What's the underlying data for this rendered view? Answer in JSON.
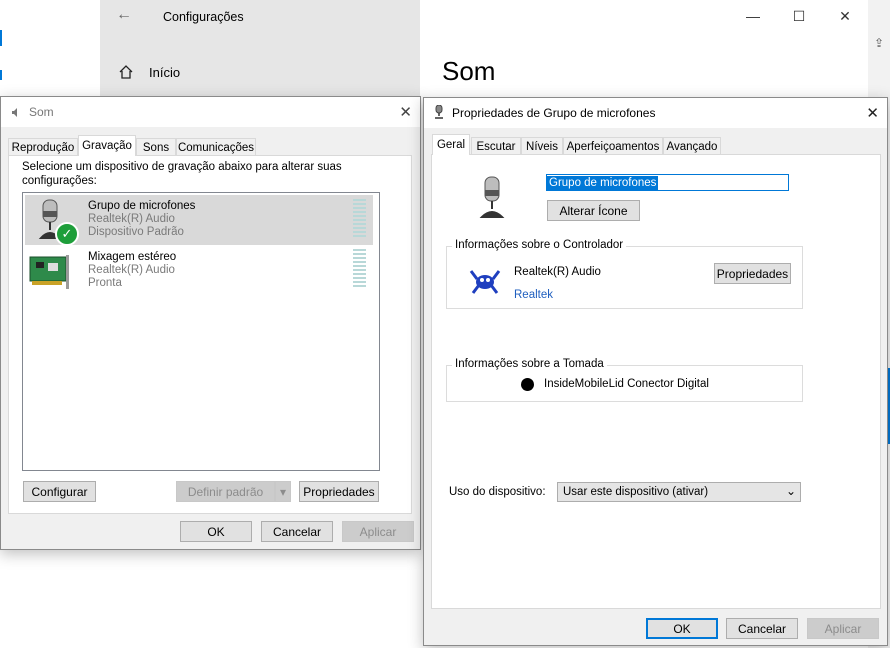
{
  "settings": {
    "title": "Configurações",
    "home": "Início",
    "page_title": "Som"
  },
  "sound_dialog": {
    "title": "Som",
    "tabs": [
      "Reprodução",
      "Gravação",
      "Sons",
      "Comunicações"
    ],
    "instruction": "Selecione um dispositivo de gravação abaixo para alterar suas configurações:",
    "devices": [
      {
        "name": "Grupo de microfones",
        "driver": "Realtek(R) Audio",
        "status": "Dispositivo Padrão"
      },
      {
        "name": "Mixagem estéreo",
        "driver": "Realtek(R) Audio",
        "status": "Pronta"
      }
    ],
    "configure": "Configurar",
    "set_default": "Definir padrão",
    "properties": "Propriedades",
    "ok": "OK",
    "cancel": "Cancelar",
    "apply": "Aplicar"
  },
  "props_dialog": {
    "title": "Propriedades de Grupo de microfones",
    "tabs": [
      "Geral",
      "Escutar",
      "Níveis",
      "Aperfeiçoamentos",
      "Avançado"
    ],
    "device_name": "Grupo de microfones",
    "change_icon": "Alterar Ícone",
    "controller_group": "Informações sobre o Controlador",
    "controller_name": "Realtek(R) Audio",
    "controller_vendor": "Realtek",
    "controller_props": "Propriedades",
    "jack_group": "Informações sobre a Tomada",
    "jack_name": "InsideMobileLid Conector Digital",
    "usage_label": "Uso do dispositivo:",
    "usage_value": "Usar este dispositivo (ativar)",
    "ok": "OK",
    "cancel": "Cancelar",
    "apply": "Aplicar"
  }
}
